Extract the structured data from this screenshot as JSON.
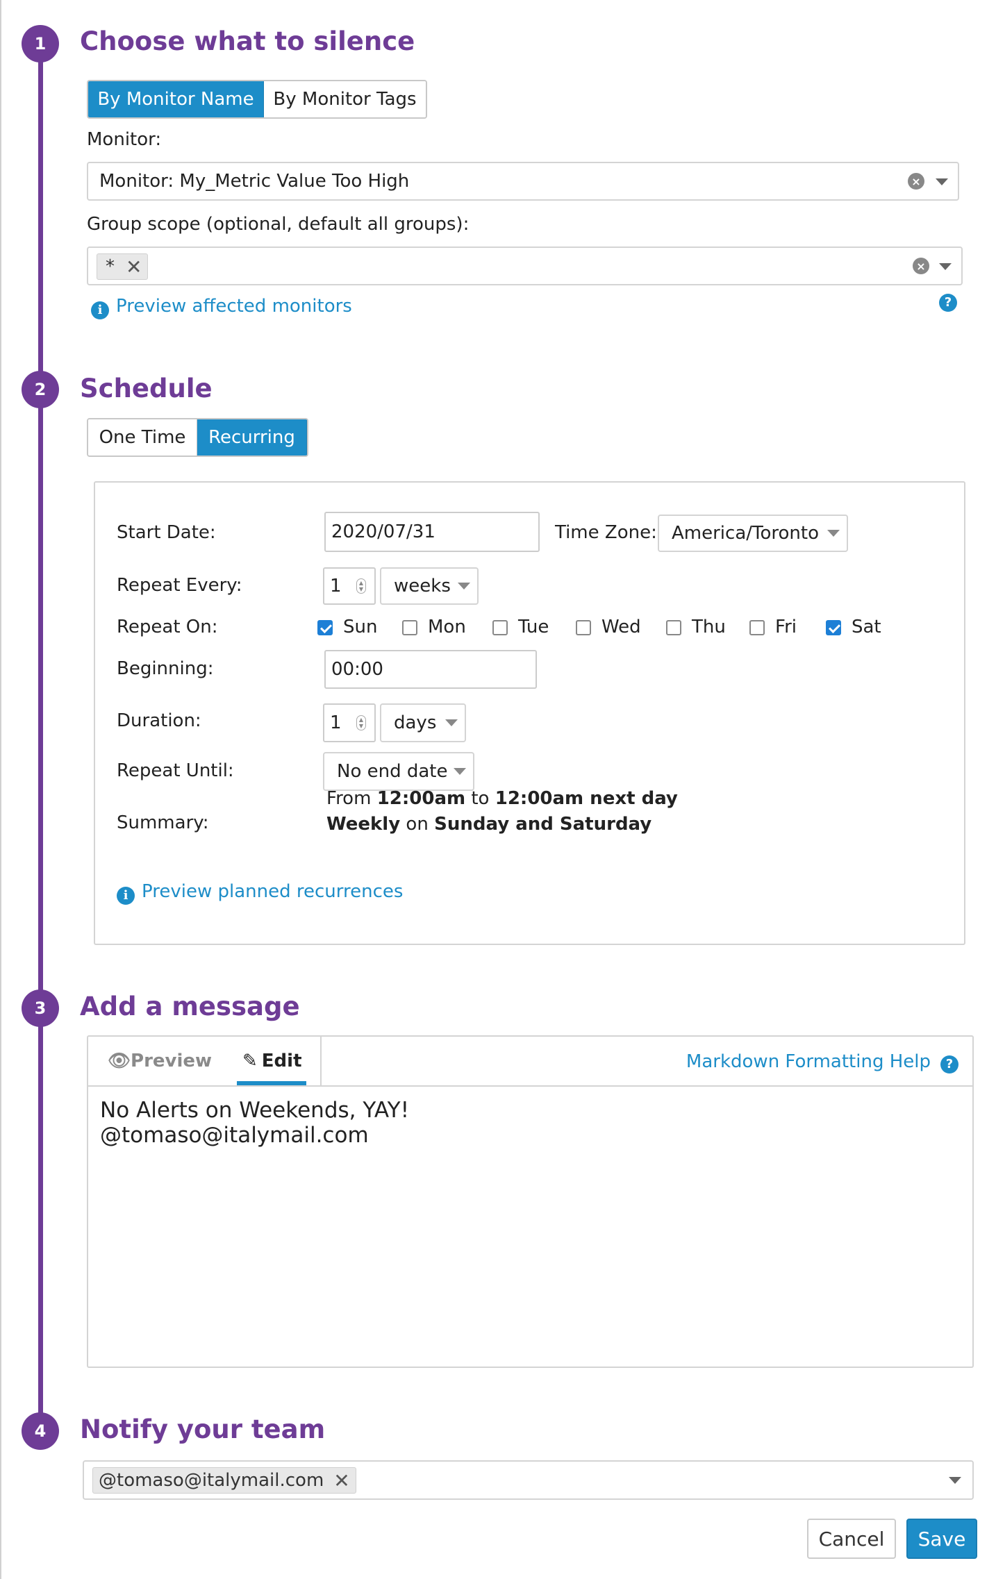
{
  "steps": [
    {
      "number": "1",
      "title": "Choose what to silence"
    },
    {
      "number": "2",
      "title": "Schedule"
    },
    {
      "number": "3",
      "title": "Add a message"
    },
    {
      "number": "4",
      "title": "Notify your team"
    }
  ],
  "silence": {
    "tabs": [
      "By Monitor Name",
      "By Monitor Tags"
    ],
    "active_tab": "By Monitor Name",
    "monitor_label": "Monitor:",
    "monitor_value": "Monitor: My_Metric Value Too High",
    "group_scope_label": "Group scope (optional, default all groups):",
    "group_scope_tags": [
      "*"
    ],
    "preview_link": "Preview affected monitors"
  },
  "schedule": {
    "tabs": [
      "One Time",
      "Recurring"
    ],
    "active_tab": "Recurring",
    "start_date_label": "Start Date:",
    "start_date_value": "2020/07/31",
    "time_zone_label": "Time Zone:",
    "time_zone_value": "America/Toronto",
    "repeat_every_label": "Repeat Every:",
    "repeat_every_value": "1",
    "repeat_every_unit": "weeks",
    "repeat_on_label": "Repeat On:",
    "days": [
      {
        "label": "Sun",
        "checked": true
      },
      {
        "label": "Mon",
        "checked": false
      },
      {
        "label": "Tue",
        "checked": false
      },
      {
        "label": "Wed",
        "checked": false
      },
      {
        "label": "Thu",
        "checked": false
      },
      {
        "label": "Fri",
        "checked": false
      },
      {
        "label": "Sat",
        "checked": true
      }
    ],
    "beginning_label": "Beginning:",
    "beginning_value": "00:00",
    "duration_label": "Duration:",
    "duration_value": "1",
    "duration_unit": "days",
    "repeat_until_label": "Repeat Until:",
    "repeat_until_value": "No end date",
    "summary_label": "Summary:",
    "summary": {
      "line1_a": "From ",
      "line1_b": "12:00am",
      "line1_c": " to ",
      "line1_d": "12:00am next day",
      "line2_a": "Weekly",
      "line2_b": " on ",
      "line2_c": "Sunday and Saturday"
    },
    "preview_link": "Preview planned recurrences"
  },
  "message": {
    "preview_tab": "Preview",
    "edit_tab": "Edit",
    "help_link": "Markdown Formatting Help",
    "line1": "No Alerts on Weekends, YAY!",
    "line2": "@tomaso@italymail.com"
  },
  "notify": {
    "recipients": [
      "@tomaso@italymail.com"
    ]
  },
  "actions": {
    "cancel": "Cancel",
    "save": "Save"
  },
  "colors": {
    "accent_purple": "#6e3c96",
    "primary_blue": "#1d8dc8",
    "checkbox_blue": "#1d7fd6"
  },
  "icons": [
    "info-icon",
    "help-icon",
    "clear-icon",
    "chevron-down-icon",
    "remove-tag-icon",
    "eye-icon",
    "pencil-icon"
  ]
}
